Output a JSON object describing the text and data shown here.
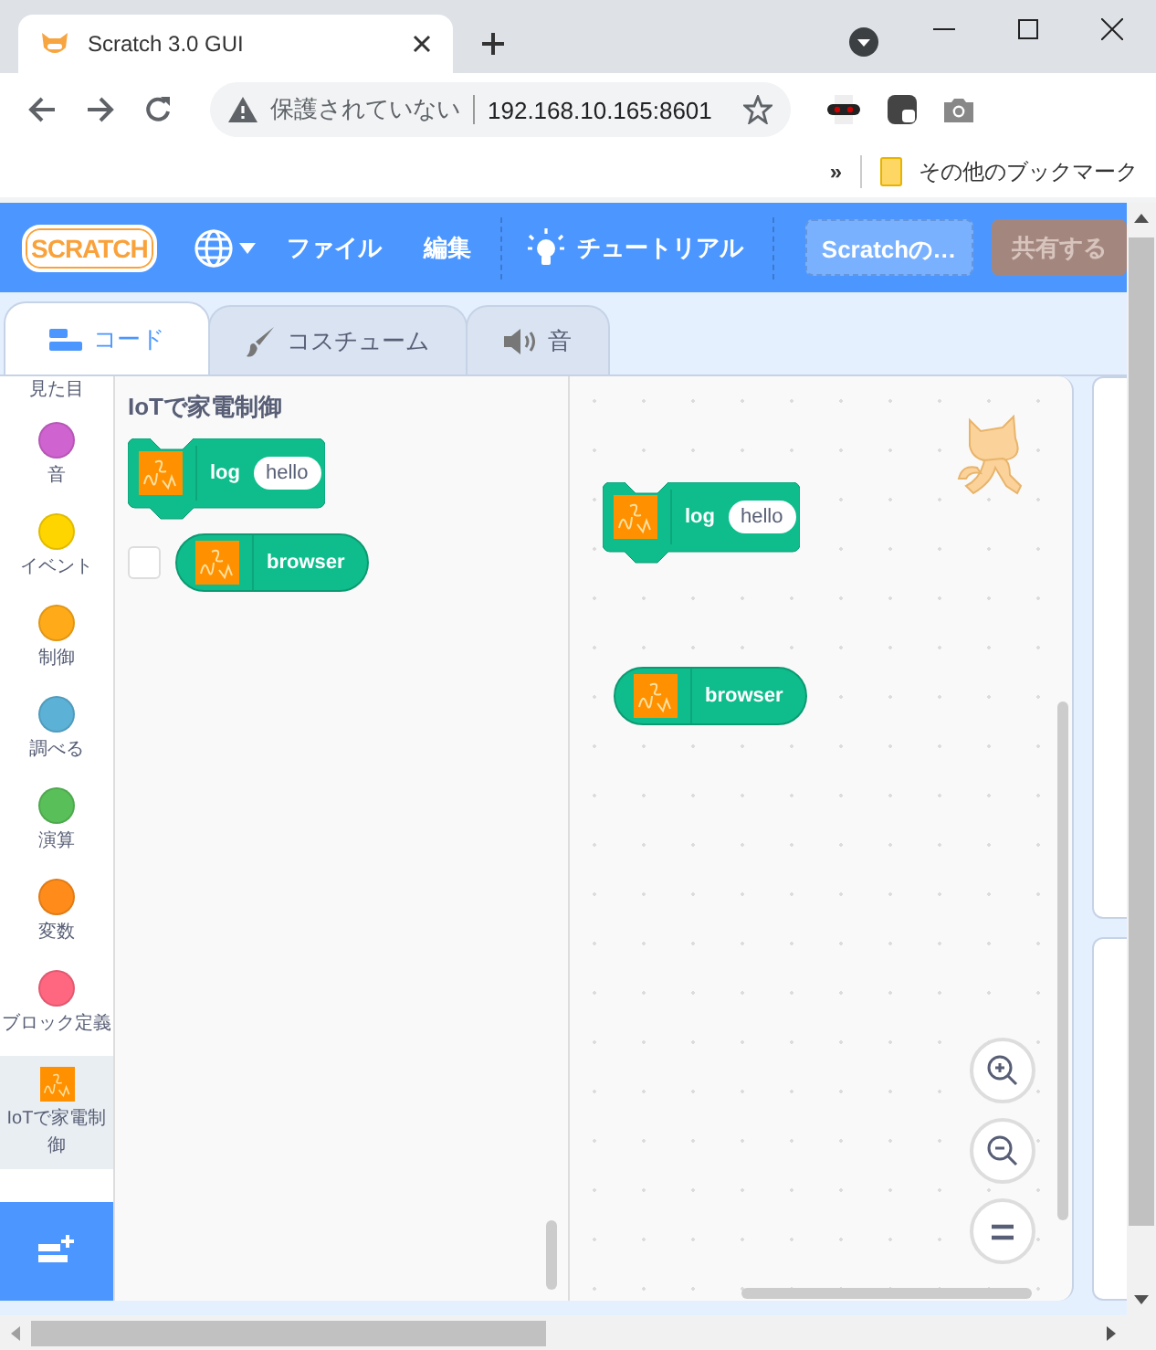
{
  "browser": {
    "tab_title": "Scratch 3.0 GUI",
    "security_label": "保護されていない",
    "address": "192.168.10.165:8601",
    "bookmarks_overflow": "»",
    "bookmarks_folder": "その他のブックマーク"
  },
  "menu_bar": {
    "logo": "SCRATCH",
    "file": "ファイル",
    "edit": "編集",
    "tutorials": "チュートリアル",
    "project_title": "Scratchの…",
    "share_button": {
      "label": "共有する",
      "disabled": true
    }
  },
  "editor_tabs": [
    {
      "label": "コード",
      "selected": true
    },
    {
      "label": "コスチューム",
      "selected": false
    },
    {
      "label": "音",
      "selected": false
    }
  ],
  "categories": [
    {
      "label": "見た目",
      "kind": "label",
      "selected": false
    },
    {
      "label": "音",
      "kind": "circle",
      "color": "#cf63cf",
      "selected": false
    },
    {
      "label": "イベント",
      "kind": "circle",
      "color": "#ffd500",
      "selected": false
    },
    {
      "label": "制御",
      "kind": "circle",
      "color": "#ffab19",
      "selected": false
    },
    {
      "label": "調べる",
      "kind": "circle",
      "color": "#5cb1d6",
      "selected": false
    },
    {
      "label": "演算",
      "kind": "circle",
      "color": "#59c059",
      "selected": false
    },
    {
      "label": "変数",
      "kind": "circle",
      "color": "#ff8c1a",
      "selected": false
    },
    {
      "label": "ブロック定義",
      "kind": "circle",
      "color": "#ff6680",
      "selected": false
    },
    {
      "label": "IoTで家電制御",
      "kind": "extension",
      "selected": true
    }
  ],
  "flyout": {
    "title": "IoTで家電制御",
    "blocks": [
      {
        "kind": "command",
        "label": "log",
        "input": "hello"
      },
      {
        "kind": "reporter",
        "label": "browser",
        "checked": false
      }
    ]
  },
  "workspace": {
    "blocks": [
      {
        "kind": "command",
        "label": "log",
        "input": "hello"
      },
      {
        "kind": "reporter",
        "label": "browser"
      }
    ]
  }
}
